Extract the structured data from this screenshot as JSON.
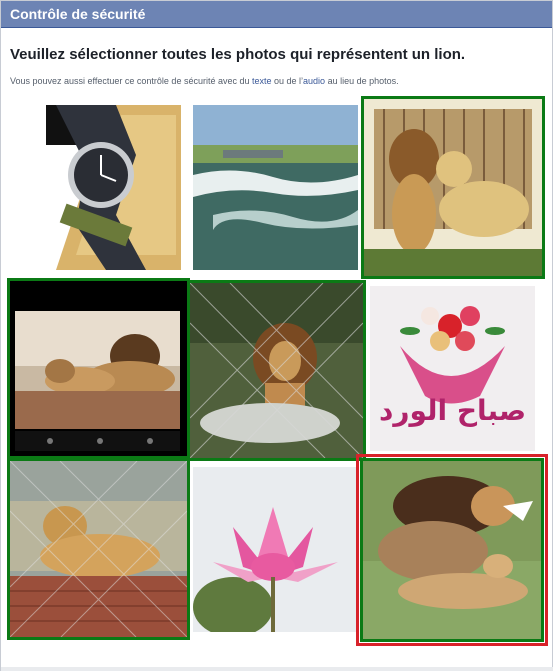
{
  "dialog": {
    "title": "Contrôle de sécurité",
    "heading": "Veuillez sélectionner toutes les photos qui représentent un lion.",
    "sub_prefix": "Vous pouvez aussi effectuer ce contrôle de sécurité avec du ",
    "sub_link_text": "texte",
    "sub_middle": " ou de l’",
    "sub_link_audio": "audio",
    "sub_suffix": " au lieu de photos."
  },
  "tiles": [
    {
      "subject": "watch",
      "selected": false
    },
    {
      "subject": "waterfall",
      "selected": false
    },
    {
      "subject": "lions-in-cage",
      "selected": true
    },
    {
      "subject": "lion-family-phone",
      "selected": true
    },
    {
      "subject": "lion-behind-fence",
      "selected": true
    },
    {
      "subject": "flower-bouquet",
      "selected": false,
      "arabic_text": "صباح الورد"
    },
    {
      "subject": "lioness-in-cage",
      "selected": true
    },
    {
      "subject": "pink-lotus",
      "selected": false
    },
    {
      "subject": "lion-and-lioness",
      "selected": true,
      "highlight": "red"
    }
  ],
  "colors": {
    "title_bar": "#6d84b4",
    "selected_green": "#0b7a15",
    "highlight_red": "#d8222a",
    "link": "#3b5998"
  }
}
